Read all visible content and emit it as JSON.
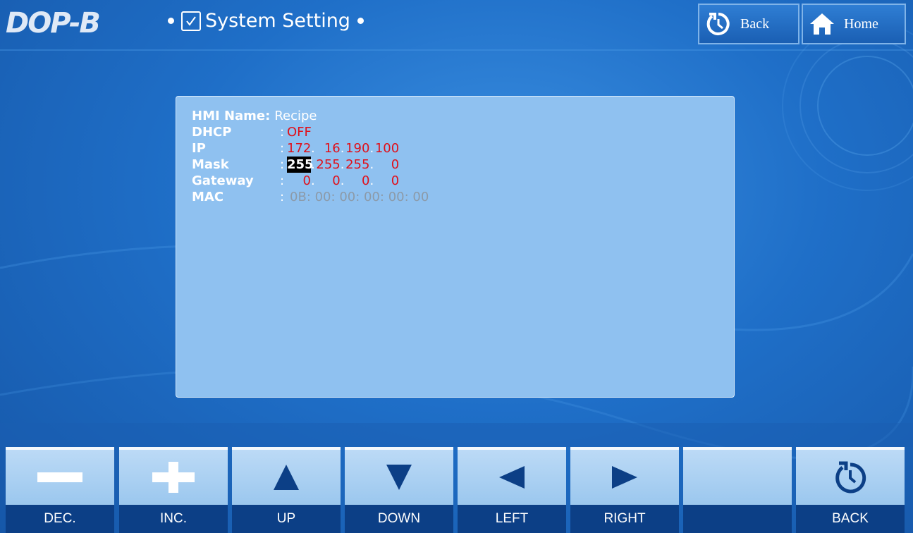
{
  "header": {
    "logo": "DOP-B",
    "title": "System Setting",
    "back_label": "Back",
    "home_label": "Home"
  },
  "panel": {
    "hmi_name_label": "HMI Name:",
    "hmi_name_value": "Recipe",
    "dhcp_label": "DHCP",
    "dhcp_value": "OFF",
    "ip_label": "IP",
    "ip": [
      "172",
      "16",
      "190",
      "100"
    ],
    "mask_label": "Mask",
    "mask": [
      "255",
      "255",
      "255",
      "0"
    ],
    "gateway_label": "Gateway",
    "gateway": [
      "0",
      "0",
      "0",
      "0"
    ],
    "mac_label": "MAC",
    "mac": [
      "0B",
      "00",
      "00",
      "00",
      "00",
      "00"
    ]
  },
  "toolbar": {
    "dec": "DEC.",
    "inc": "INC.",
    "up": "UP",
    "down": "DOWN",
    "left": "LEFT",
    "right": "RIGHT",
    "blank": "",
    "back": "BACK"
  },
  "colors": {
    "background": "#1f6fc8",
    "panel": "#8fc1f0",
    "value_red": "#e0101a",
    "label_bar": "#0c3f86"
  }
}
